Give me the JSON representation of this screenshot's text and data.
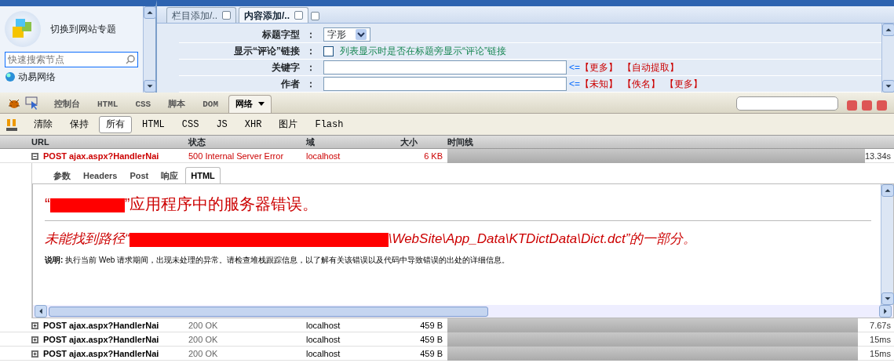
{
  "sidebar": {
    "switch_label": "切换到网站专题",
    "search": {
      "placeholder": "快速搜索节点"
    },
    "tree": [
      {
        "label": "动易网络"
      }
    ]
  },
  "tabs": [
    {
      "label": "栏目添加/..",
      "selected": false
    },
    {
      "label": "内容添加/..",
      "selected": true
    }
  ],
  "form": {
    "rows": [
      {
        "kind": "select",
        "label": "标题字型",
        "colon": "：",
        "value": "字形"
      },
      {
        "kind": "checkbox",
        "label": "显示“评论”链接",
        "colon": "：",
        "checked": false,
        "hint": "列表显示时是否在标题旁显示“评论”链接"
      },
      {
        "kind": "input",
        "label": "关键字",
        "colon": "：",
        "arrow": "<=",
        "links": [
          "【更多】",
          "【自动提取】"
        ]
      },
      {
        "kind": "input",
        "label": "作者",
        "colon": "：",
        "arrow": "<=",
        "links": [
          "【未知】",
          "【佚名】",
          "【更多】"
        ]
      }
    ]
  },
  "firebug": {
    "tabs": [
      {
        "label": "控制台",
        "selected": false
      },
      {
        "label": "HTML",
        "selected": false
      },
      {
        "label": "CSS",
        "selected": false
      },
      {
        "label": "脚本",
        "selected": false
      },
      {
        "label": "DOM",
        "selected": false
      },
      {
        "label": "网络",
        "selected": true
      }
    ],
    "actions": [
      "清除",
      "保持"
    ],
    "filters": [
      {
        "label": "所有",
        "selected": true
      },
      {
        "label": "HTML",
        "selected": false
      },
      {
        "label": "CSS",
        "selected": false
      },
      {
        "label": "JS",
        "selected": false
      },
      {
        "label": "XHR",
        "selected": false
      },
      {
        "label": "图片",
        "selected": false
      },
      {
        "label": "Flash",
        "selected": false
      }
    ],
    "columns": [
      "URL",
      "状态",
      "域",
      "大小",
      "时间线"
    ],
    "requests": [
      {
        "url": "POST ajax.aspx?HandlerNai",
        "status": "500 Internal Server Error",
        "domain": "localhost",
        "size": "6 KB",
        "level": 0.95,
        "time": "13.34s",
        "error": true,
        "expanded": true
      },
      {
        "url": "POST ajax.aspx?HandlerNai",
        "status": "200 OK",
        "domain": "localhost",
        "size": "459 B",
        "level": 0.92,
        "time": "7.67s",
        "error": false,
        "expanded": false
      },
      {
        "url": "POST ajax.aspx?HandlerNai",
        "status": "200 OK",
        "domain": "localhost",
        "size": "459 B",
        "level": 0.92,
        "time": "15ms",
        "error": false,
        "expanded": false
      },
      {
        "url": "POST ajax.aspx?HandlerNai",
        "status": "200 OK",
        "domain": "localhost",
        "size": "459 B",
        "level": 0.92,
        "time": "15ms",
        "error": false,
        "expanded": false
      }
    ],
    "detail_tabs": [
      {
        "label": "参数",
        "selected": false
      },
      {
        "label": "Headers",
        "selected": false
      },
      {
        "label": "Post",
        "selected": false
      },
      {
        "label": "响应",
        "selected": false
      },
      {
        "label": "HTML",
        "selected": true
      }
    ],
    "error_page": {
      "heading_before": "“",
      "heading_after": "”应用程序中的服务器错误。",
      "message_before": "未能找到路径“",
      "message_after": "\\WebSite\\App_Data\\KTDictData\\Dict.dct”的一部分。",
      "note_label": "说明:",
      "note": "执行当前 Web 请求期间，出现未处理的异常。请检查堆栈跟踪信息，以了解有关该错误以及代码中导致错误的出处的详细信息。"
    }
  }
}
